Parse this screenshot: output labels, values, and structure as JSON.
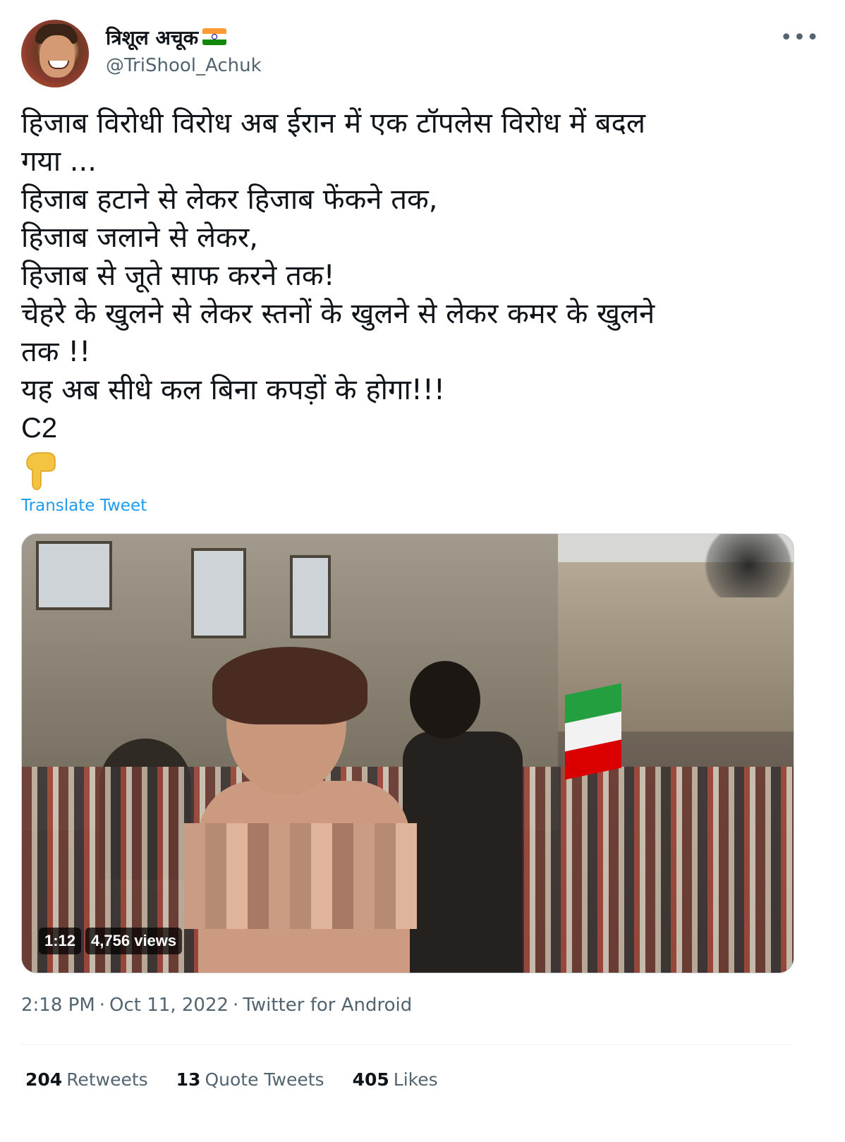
{
  "user": {
    "display_name": "त्रिशूल अचूक",
    "handle": "@TriShool_Achuk",
    "flag_icon": "india-flag-icon",
    "avatar_icon": "profile-avatar"
  },
  "tweet": {
    "lines": [
      "हिजाब विरोधी विरोध अब ईरान में एक टॉपलेस विरोध में बदल",
      "गया ...",
      "हिजाब हटाने से लेकर हिजाब फेंकने तक,",
      "हिजाब जलाने से लेकर,",
      "हिजाब से जूते साफ करने तक!",
      "चेहरे के खुलने से लेकर स्तनों के खुलने से लेकर कमर के खुलने",
      "तक !!",
      "यह अब सीधे  कल बिना कपड़ों के होगा!!!",
      "C2"
    ],
    "emoji_icon": "pointing-down-hand-icon",
    "translate_label": "Translate Tweet"
  },
  "media": {
    "duration": "1:12",
    "views": "4,756 views"
  },
  "meta": {
    "time": "2:18 PM",
    "separator": "·",
    "date": "Oct 11, 2022",
    "source": "Twitter for Android"
  },
  "stats": {
    "retweets_count": "204",
    "retweets_label": "Retweets",
    "quotes_count": "13",
    "quotes_label": "Quote Tweets",
    "likes_count": "405",
    "likes_label": "Likes"
  },
  "colors": {
    "accent": "#1d9bf0",
    "text_primary": "#0f1419",
    "text_secondary": "#536471"
  }
}
